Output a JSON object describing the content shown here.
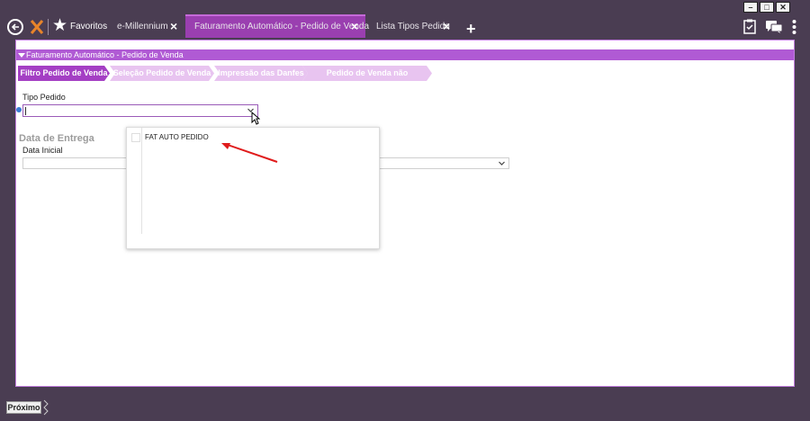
{
  "window": {
    "controls": [
      "minimize",
      "maximize",
      "close"
    ]
  },
  "header": {
    "back_icon": "back-arrow-circle-icon",
    "logo_icon": "millennium-logo-icon",
    "favorites_label": "Favoritos",
    "tabs": [
      {
        "label": "e-Millennium",
        "active": false
      },
      {
        "label": "Faturamento Automático - Pedido de Venda",
        "active": true
      },
      {
        "label": "Lista Tipos Pedido",
        "active": false
      }
    ],
    "add_tab_icon": "plus-icon",
    "right_icons": [
      "clipboard-check-icon",
      "chat-icon",
      "more-vertical-icon"
    ]
  },
  "panel": {
    "title": "Faturamento Automático - Pedido de Venda",
    "wizard_steps": [
      {
        "label": "Filtro Pedido de Venda",
        "active": true
      },
      {
        "label": "Seleção Pedido de Venda",
        "active": false
      },
      {
        "label": "Impressão das Danfes",
        "active": false
      },
      {
        "label": "Pedido de Venda não Processado",
        "active": false
      }
    ],
    "tipo_pedido_label": "Tipo Pedido",
    "tipo_pedido_value": "",
    "section_data_entrega": "Data de Entrega",
    "data_inicial_label": "Data Inicial",
    "dropdown_options": [
      {
        "label": "FAT AUTO PEDIDO",
        "checked": false
      }
    ]
  },
  "footer": {
    "next_label": "Próximo"
  },
  "colors": {
    "titlebar_bg": "#4a3d52",
    "accent": "#b05ad4",
    "active_tab": "#9a3fb0",
    "inactive_step": "#e8c4f0",
    "annotation_arrow": "#e01b1b"
  }
}
